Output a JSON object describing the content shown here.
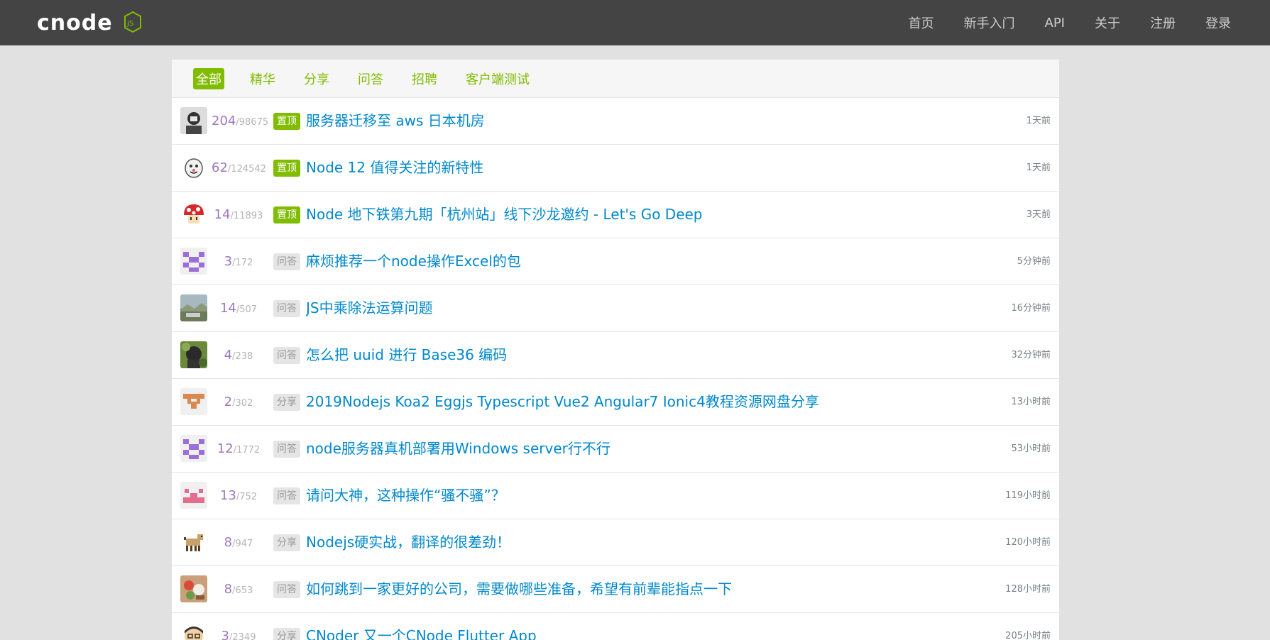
{
  "nav": {
    "logo_text": "cnode",
    "logo_badge": "JS",
    "links": [
      "首页",
      "新手入门",
      "API",
      "关于",
      "注册",
      "登录"
    ]
  },
  "tabs": [
    "全部",
    "精华",
    "分享",
    "问答",
    "招聘",
    "客户端测试"
  ],
  "active_tab": "全部",
  "colors": {
    "accent": "#80bd01",
    "navbar": "#444444",
    "link": "#0088cc",
    "reply": "#9e78c0"
  },
  "topics": [
    {
      "replies": "204",
      "visits": "98675",
      "tag": "置顶",
      "tag_type": "top",
      "title": "服务器迁移至 aws 日本机房",
      "time": "1天前"
    },
    {
      "replies": "62",
      "visits": "124542",
      "tag": "置顶",
      "tag_type": "top",
      "title": "Node 12 值得关注的新特性",
      "time": "1天前"
    },
    {
      "replies": "14",
      "visits": "11893",
      "tag": "置顶",
      "tag_type": "top",
      "title": "Node 地下铁第九期「杭州站」线下沙龙邀约 - Let's Go Deep",
      "time": "3天前"
    },
    {
      "replies": "3",
      "visits": "172",
      "tag": "问答",
      "tag_type": "normal",
      "title": "麻烦推荐一个node操作Excel的包",
      "time": "5分钟前"
    },
    {
      "replies": "14",
      "visits": "507",
      "tag": "问答",
      "tag_type": "normal",
      "title": "JS中乘除法运算问题",
      "time": "16分钟前"
    },
    {
      "replies": "4",
      "visits": "238",
      "tag": "问答",
      "tag_type": "normal",
      "title": "怎么把 uuid 进行 Base36 编码",
      "time": "32分钟前"
    },
    {
      "replies": "2",
      "visits": "302",
      "tag": "分享",
      "tag_type": "normal",
      "title": "2019Nodejs Koa2 Eggjs Typescript Vue2 Angular7 Ionic4教程资源网盘分享",
      "time": "13小时前"
    },
    {
      "replies": "12",
      "visits": "1772",
      "tag": "问答",
      "tag_type": "normal",
      "title": "node服务器真机部署用Windows server行不行",
      "time": "53小时前"
    },
    {
      "replies": "13",
      "visits": "752",
      "tag": "问答",
      "tag_type": "normal",
      "title": "请问大神，这种操作“骚不骚”？",
      "time": "119小时前"
    },
    {
      "replies": "8",
      "visits": "947",
      "tag": "分享",
      "tag_type": "normal",
      "title": "Nodejs硬实战，翻译的很差劲！",
      "time": "120小时前"
    },
    {
      "replies": "8",
      "visits": "653",
      "tag": "问答",
      "tag_type": "normal",
      "title": "如何跳到一家更好的公司，需要做哪些准备，希望有前辈能指点一下",
      "time": "128小时前"
    },
    {
      "replies": "3",
      "visits": "2349",
      "tag": "分享",
      "tag_type": "normal",
      "title": "CNoder 又一个CNode Flutter App",
      "time": "205小时前"
    }
  ]
}
